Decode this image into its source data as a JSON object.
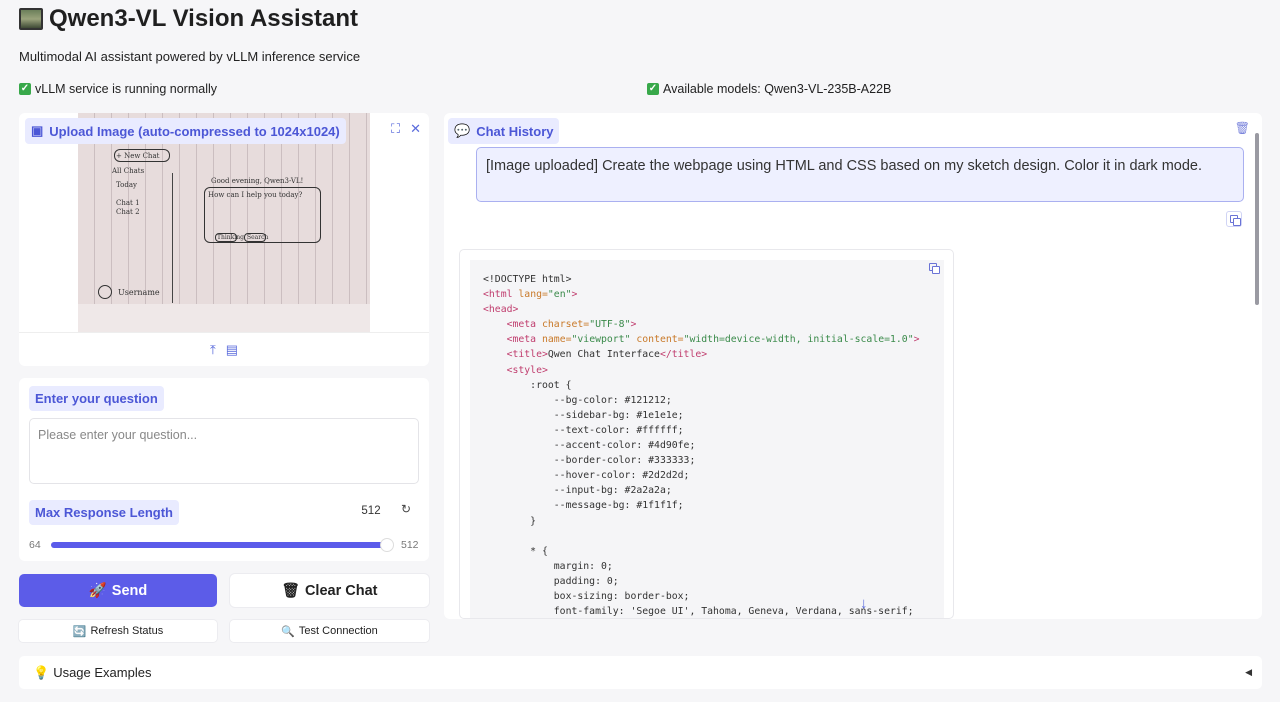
{
  "header": {
    "title": "Qwen3-VL Vision Assistant",
    "subtitle": "Multimodal AI assistant powered by vLLM inference service",
    "status_service": "vLLM service is running normally",
    "status_models": "Available models: Qwen3-VL-235B-A22B"
  },
  "upload": {
    "label": "Upload Image (auto-compressed to 1024x1024)",
    "sketch_texts": {
      "new_chat": "+ New Chat",
      "all_chats": "All Chats",
      "today": "Today",
      "chat1": "Chat 1",
      "chat2": "Chat 2",
      "greeting": "Good evening, Qwen3-VL!",
      "help": "How can I help you today?",
      "thinking": "Thinking",
      "search": "Search",
      "username": "Username"
    }
  },
  "question": {
    "label": "Enter your question",
    "placeholder": "Please enter your question...",
    "max_label": "Max Response Length",
    "max_value": "512",
    "min": "64",
    "max": "512",
    "slider_fraction": 1.0
  },
  "buttons": {
    "send": "Send",
    "clear": "Clear Chat",
    "refresh": "Refresh Status",
    "test": "Test Connection"
  },
  "chat": {
    "label": "Chat History",
    "user_message": "[Image uploaded] Create the webpage using HTML and CSS based on my sketch design. Color it in dark mode."
  },
  "usage": {
    "label": "Usage Examples"
  },
  "colors": {
    "accent": "#5c5ce8",
    "chip_bg": "#e9ebff",
    "chip_text": "#4c57d6"
  }
}
